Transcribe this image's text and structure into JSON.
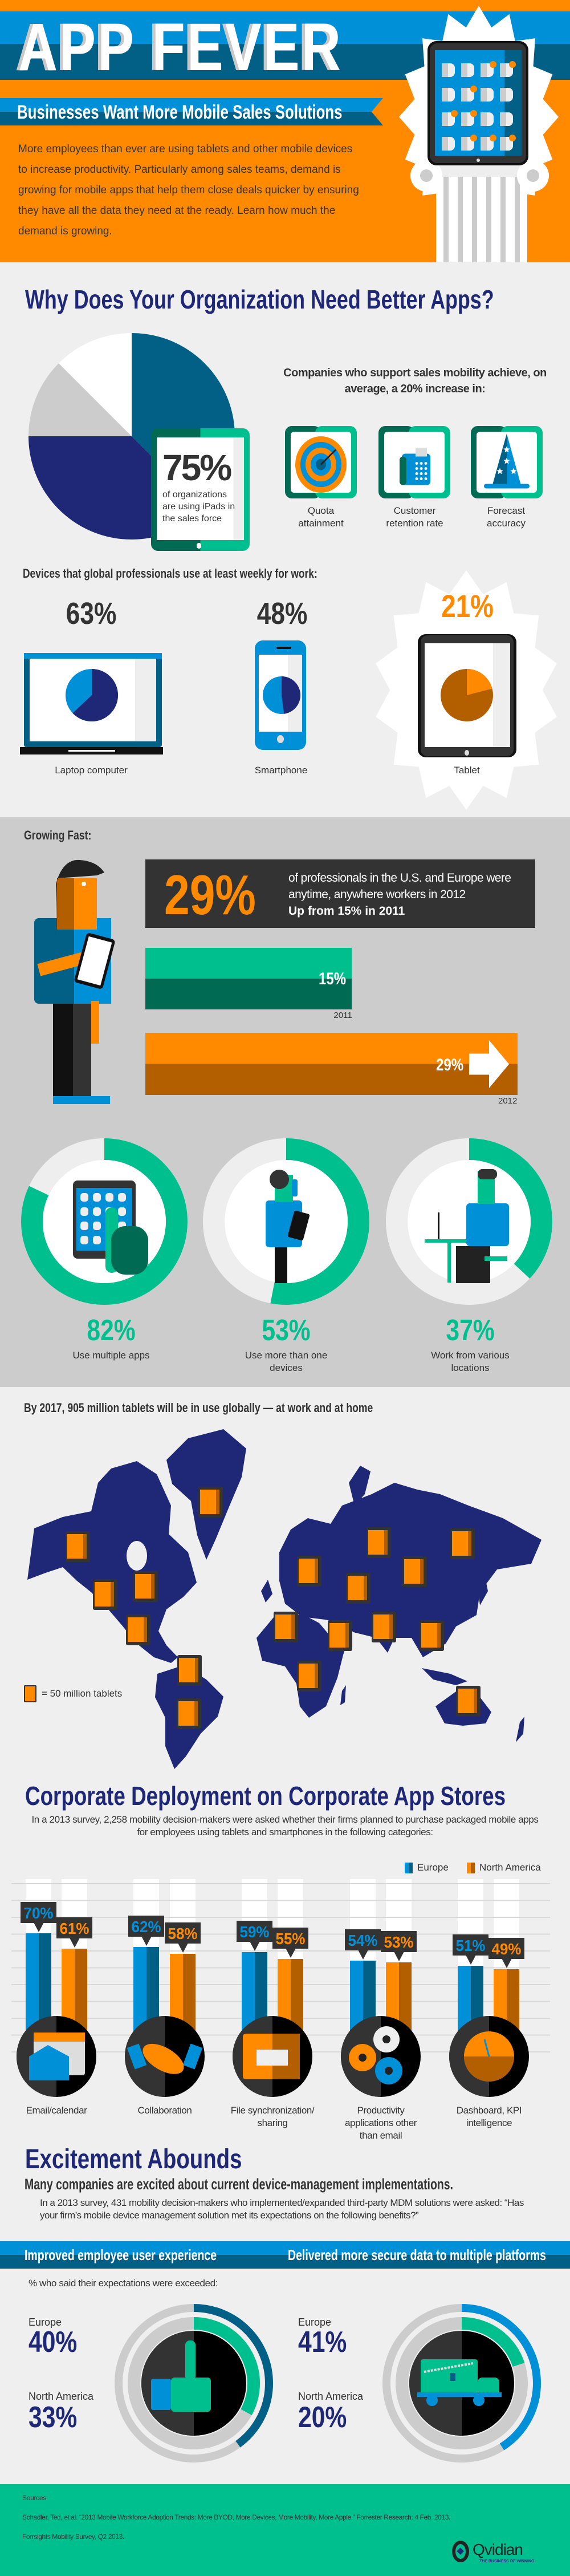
{
  "colors": {
    "orange": "#ff8a00",
    "dark_orange": "#b35f00",
    "blue": "#0090d8",
    "dark_blue": "#025f86",
    "navy": "#1e2876",
    "green": "#00bf8f",
    "dark_green": "#006b52",
    "charcoal": "#333333",
    "light_gray": "#efefef",
    "gray": "#cccccc"
  },
  "header": {
    "title": "APP FEVER",
    "subtitle": "Businesses Want More Mobile Sales Solutions",
    "intro": "More employees than ever are using tablets and other mobile devices to increase productivity. Particularly among sales teams, demand is growing for mobile apps that help them close deals quicker by ensuring they have all the data they need at the ready. Learn how much the demand is growing."
  },
  "why": {
    "title": "Why Does Your Organization Need Better Apps?",
    "pie_percent": 75,
    "stat_value": "75%",
    "stat_text": "of organizations are using iPads in the sales force",
    "companies_heading": "Companies who support sales mobility achieve, on average, a 20% increase in:",
    "benefits": [
      {
        "label": "Quota attainment",
        "icon": "target-icon"
      },
      {
        "label": "Customer retention rate",
        "icon": "phone-icon"
      },
      {
        "label": "Forecast accuracy",
        "icon": "wizard-hat-icon"
      }
    ]
  },
  "devices": {
    "heading": "Devices that global professionals use at least weekly for work:",
    "items": [
      {
        "value": "63%",
        "percent": 63,
        "label": "Laptop computer",
        "icon": "laptop-icon"
      },
      {
        "value": "48%",
        "percent": 48,
        "label": "Smartphone",
        "icon": "smartphone-icon"
      },
      {
        "value": "21%",
        "percent": 21,
        "label": "Tablet",
        "icon": "tablet-icon"
      }
    ]
  },
  "growing": {
    "heading": "Growing Fast:",
    "big_value": "29%",
    "text": "of professionals in the U.S. and Europe were anytime, anywhere workers in 2012",
    "text_bold": "Up from 15% in 2011",
    "bars": [
      {
        "value": "15%",
        "percent": 15,
        "year": "2011"
      },
      {
        "value": "29%",
        "percent": 29,
        "year": "2012"
      }
    ],
    "donuts": [
      {
        "value": "82%",
        "percent": 82,
        "label": "Use multiple apps"
      },
      {
        "value": "53%",
        "percent": 53,
        "label": "Use more than one devices"
      },
      {
        "value": "37%",
        "percent": 37,
        "label": "Work from various locations"
      }
    ]
  },
  "map": {
    "heading": "By 2017, 905 million tablets will be in use globally — at work and at home",
    "legend": "= 50 million tablets"
  },
  "deployment": {
    "title": "Corporate Deployment on Corporate App Stores",
    "description": "In a 2013 survey, 2,258 mobility decision-makers were asked whether their firms planned to purchase packaged mobile apps for employees using tablets and smartphones in the following categories:",
    "legend_europe": "Europe",
    "legend_na": "North America",
    "categories": [
      {
        "label": "Email/calendar",
        "europe": 70,
        "north_america": 61,
        "icon": "email-calendar-icon"
      },
      {
        "label": "Collaboration",
        "europe": 62,
        "north_america": 58,
        "icon": "handshake-icon"
      },
      {
        "label": "File synchronization/ sharing",
        "europe": 59,
        "north_america": 55,
        "icon": "folder-icon"
      },
      {
        "label": "Productivity applications other than email",
        "europe": 54,
        "north_america": 53,
        "icon": "gears-icon"
      },
      {
        "label": "Dashboard, KPI intelligence",
        "europe": 51,
        "north_america": 49,
        "icon": "gauge-icon"
      }
    ]
  },
  "excitement": {
    "title": "Excitement Abounds",
    "subtitle": "Many companies are excited about current device-management implementations.",
    "description": "In a 2013 survey, 431 mobility decision-makers who implemented/expanded third-party MDM solutions were asked: “Has your firm’s mobile device management solution met its expectations on the following benefits?”",
    "note": "% who said their expectations were exceeded:",
    "columns": [
      {
        "heading": "Improved employee user experience",
        "europe_label": "Europe",
        "europe_value": "40%",
        "europe": 40,
        "na_label": "North America",
        "na_value": "33%",
        "north_america": 33,
        "icon": "thumbs-up-icon"
      },
      {
        "heading": "Delivered more secure data to multiple platforms",
        "europe_label": "Europe",
        "europe_value": "41%",
        "europe": 41,
        "na_label": "North America",
        "na_value": "20%",
        "north_america": 20,
        "icon": "locked-truck-icon"
      }
    ]
  },
  "footer": {
    "sources_label": "Sources:",
    "sources": [
      "Schadler, Ted, et al. “2013 Mobile Workforce Adoption Trends: More BYOD, More Devices, More Mobility, More Apple.” Forrester Research: 4 Feb. 2013.",
      "Forrsights Mobility Survey, Q2 2013."
    ],
    "logo": "Qvidian",
    "tagline": "THE BUSINESS OF WINNING"
  }
}
